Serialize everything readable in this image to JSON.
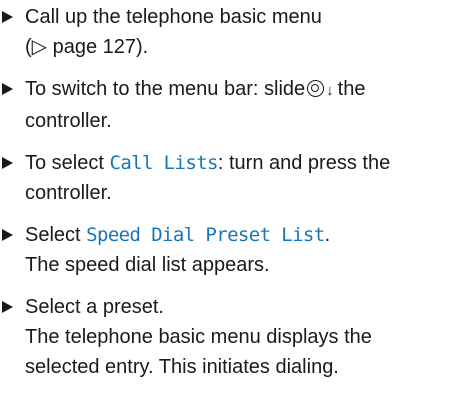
{
  "steps": [
    {
      "line1": "Call up the telephone basic menu",
      "line2": "(▷ page 127)."
    },
    {
      "text_before": "To switch to the menu bar: slide",
      "arrow": "↓",
      "text_after": "the",
      "line2": "controller."
    },
    {
      "text_before": "To select ",
      "highlight": "Call Lists",
      "text_after": ": turn and press the",
      "line2": "controller."
    },
    {
      "text_before": "Select ",
      "highlight": "Speed Dial Preset List",
      "text_after": ".",
      "line2": "The speed dial list appears."
    },
    {
      "line1": "Select a preset.",
      "line2": "The telephone basic menu displays the",
      "line3": "selected entry. This initiates dialing."
    }
  ],
  "icons": {
    "bullet": "right-triangle-bullet-icon",
    "controller": "controller-knob-icon",
    "slide": "arrow-down-icon"
  },
  "colors": {
    "text": "#1a1a1a",
    "highlight": "#1976b5"
  }
}
